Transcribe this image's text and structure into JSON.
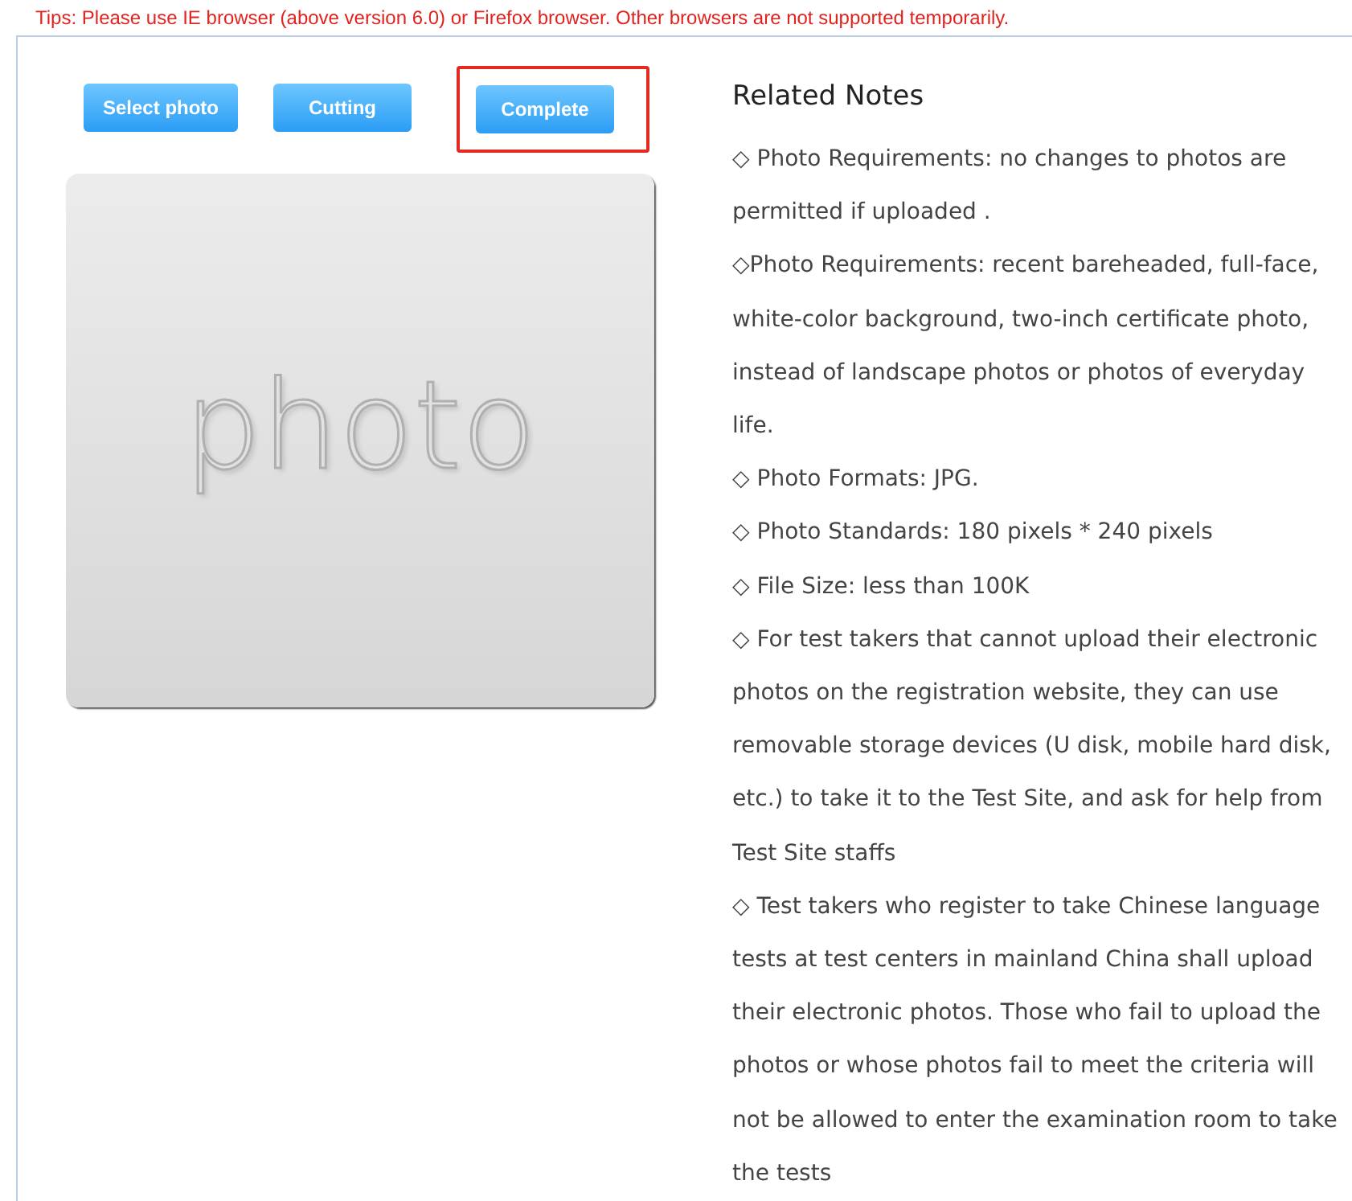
{
  "tip": "Tips: Please use IE browser (above version 6.0) or Firefox browser. Other browsers are not supported temporarily.",
  "buttons": [
    {
      "label": "Select photo",
      "highlighted": false
    },
    {
      "label": "Cutting",
      "highlighted": false
    },
    {
      "label": "Complete",
      "highlighted": true
    }
  ],
  "photo_placeholder": "photo",
  "notes_title": "Related Notes",
  "notes": [
    "◇ Photo Requirements: no changes to photos are permitted if uploaded .",
    "◇Photo Requirements: recent bareheaded, full-face, white-color background, two-inch certificate photo, instead of landscape photos or photos of everyday life.",
    "◇ Photo Formats: JPG.",
    "◇ Photo Standards: 180 pixels * 240 pixels",
    "◇ File Size: less than 100K",
    "◇ For test takers that cannot upload their electronic photos on the registration website, they can use removable storage devices (U disk, mobile hard disk, etc.) to take it to the Test Site, and ask for help from Test Site staffs",
    "◇ Test takers who register to take Chinese language tests at test centers in mainland China shall upload their electronic photos. Those who fail to upload the photos or whose photos fail to meet the criteria will not be allowed to enter the examination room to take the tests"
  ]
}
